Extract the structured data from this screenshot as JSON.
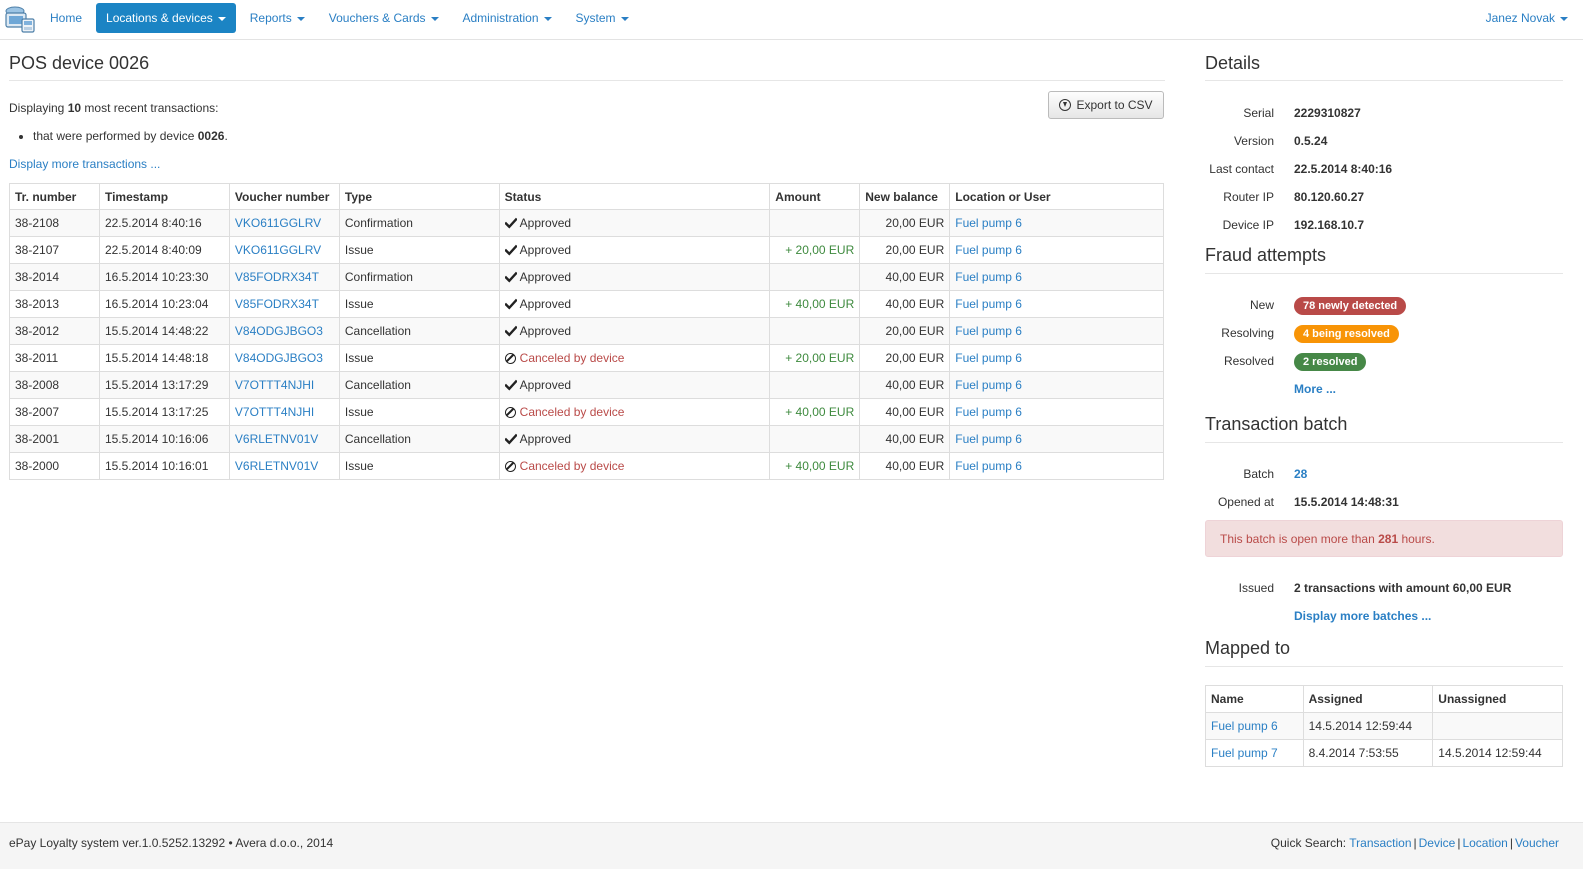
{
  "nav": {
    "items": [
      {
        "label": "Home",
        "active": false,
        "dropdown": false,
        "name": "nav-home"
      },
      {
        "label": "Locations & devices",
        "active": true,
        "dropdown": true,
        "name": "nav-locations-devices"
      },
      {
        "label": "Reports",
        "active": false,
        "dropdown": true,
        "name": "nav-reports"
      },
      {
        "label": "Vouchers & Cards",
        "active": false,
        "dropdown": true,
        "name": "nav-vouchers-cards"
      },
      {
        "label": "Administration",
        "active": false,
        "dropdown": true,
        "name": "nav-administration"
      },
      {
        "label": "System",
        "active": false,
        "dropdown": true,
        "name": "nav-system"
      }
    ],
    "user": "Janez Novak"
  },
  "page": {
    "title": "POS device 0026",
    "summary_prefix": "Displaying ",
    "summary_count": "10",
    "summary_suffix": " most recent transactions:",
    "filter_prefix": "that were performed by device ",
    "filter_device": "0026",
    "filter_suffix": ".",
    "more_link": "Display more transactions ...",
    "export_label": "Export to CSV"
  },
  "transactions": {
    "columns": [
      "Tr. number",
      "Timestamp",
      "Voucher number",
      "Type",
      "Status",
      "Amount",
      "New balance",
      "Location or User"
    ],
    "rows": [
      {
        "tr": "38-2108",
        "ts": "22.5.2014 8:40:16",
        "voucher": "VKO611GGLRV",
        "type": "Confirmation",
        "status": "Approved",
        "status_kind": "ok",
        "amount": "",
        "balance": "20,00 EUR",
        "location": "Fuel pump 6"
      },
      {
        "tr": "38-2107",
        "ts": "22.5.2014 8:40:09",
        "voucher": "VKO611GGLRV",
        "type": "Issue",
        "status": "Approved",
        "status_kind": "ok",
        "amount": "+ 20,00 EUR",
        "balance": "20,00 EUR",
        "location": "Fuel pump 6"
      },
      {
        "tr": "38-2014",
        "ts": "16.5.2014 10:23:30",
        "voucher": "V85FODRX34T",
        "type": "Confirmation",
        "status": "Approved",
        "status_kind": "ok",
        "amount": "",
        "balance": "40,00 EUR",
        "location": "Fuel pump 6"
      },
      {
        "tr": "38-2013",
        "ts": "16.5.2014 10:23:04",
        "voucher": "V85FODRX34T",
        "type": "Issue",
        "status": "Approved",
        "status_kind": "ok",
        "amount": "+ 40,00 EUR",
        "balance": "40,00 EUR",
        "location": "Fuel pump 6"
      },
      {
        "tr": "38-2012",
        "ts": "15.5.2014 14:48:22",
        "voucher": "V84ODGJBGO3",
        "type": "Cancellation",
        "status": "Approved",
        "status_kind": "ok",
        "amount": "",
        "balance": "20,00 EUR",
        "location": "Fuel pump 6"
      },
      {
        "tr": "38-2011",
        "ts": "15.5.2014 14:48:18",
        "voucher": "V84ODGJBGO3",
        "type": "Issue",
        "status": "Canceled by device",
        "status_kind": "cancel",
        "amount": "+ 20,00 EUR",
        "balance": "20,00 EUR",
        "location": "Fuel pump 6"
      },
      {
        "tr": "38-2008",
        "ts": "15.5.2014 13:17:29",
        "voucher": "V7OTTT4NJHI",
        "type": "Cancellation",
        "status": "Approved",
        "status_kind": "ok",
        "amount": "",
        "balance": "40,00 EUR",
        "location": "Fuel pump 6"
      },
      {
        "tr": "38-2007",
        "ts": "15.5.2014 13:17:25",
        "voucher": "V7OTTT4NJHI",
        "type": "Issue",
        "status": "Canceled by device",
        "status_kind": "cancel",
        "amount": "+ 40,00 EUR",
        "balance": "40,00 EUR",
        "location": "Fuel pump 6"
      },
      {
        "tr": "38-2001",
        "ts": "15.5.2014 10:16:06",
        "voucher": "V6RLETNV01V",
        "type": "Cancellation",
        "status": "Approved",
        "status_kind": "ok",
        "amount": "",
        "balance": "40,00 EUR",
        "location": "Fuel pump 6"
      },
      {
        "tr": "38-2000",
        "ts": "15.5.2014 10:16:01",
        "voucher": "V6RLETNV01V",
        "type": "Issue",
        "status": "Canceled by device",
        "status_kind": "cancel",
        "amount": "+ 40,00 EUR",
        "balance": "40,00 EUR",
        "location": "Fuel pump 6"
      }
    ]
  },
  "details": {
    "title": "Details",
    "rows": [
      {
        "label": "Serial",
        "value": "2229310827"
      },
      {
        "label": "Version",
        "value": "0.5.24"
      },
      {
        "label": "Last contact",
        "value": "22.5.2014 8:40:16"
      },
      {
        "label": "Router IP",
        "value": "80.120.60.27"
      },
      {
        "label": "Device IP",
        "value": "192.168.10.7"
      }
    ]
  },
  "fraud": {
    "title": "Fraud attempts",
    "new_label": "New",
    "new_badge": "78 newly detected",
    "resolving_label": "Resolving",
    "resolving_badge": "4 being resolved",
    "resolved_label": "Resolved",
    "resolved_badge": "2 resolved",
    "more": "More ..."
  },
  "batch": {
    "title": "Transaction batch",
    "batch_label": "Batch",
    "batch_value": "28",
    "opened_label": "Opened at",
    "opened_value": "15.5.2014 14:48:31",
    "alert_prefix": "This batch is open more than ",
    "alert_hours": "281",
    "alert_suffix": " hours.",
    "issued_label": "Issued",
    "issued_value": "2 transactions with amount 60,00 EUR",
    "more": "Display more batches ..."
  },
  "mapped": {
    "title": "Mapped to",
    "columns": [
      "Name",
      "Assigned",
      "Unassigned"
    ],
    "rows": [
      {
        "name": "Fuel pump 6",
        "assigned": "14.5.2014 12:59:44",
        "unassigned": ""
      },
      {
        "name": "Fuel pump 7",
        "assigned": "8.4.2014 7:53:55",
        "unassigned": "14.5.2014 12:59:44"
      }
    ]
  },
  "footer": {
    "left": "ePay Loyalty system ver.1.0.5252.13292 • Avera d.o.o., 2014",
    "quick_label": "Quick Search: ",
    "links": [
      "Transaction",
      "Device",
      "Location",
      "Voucher"
    ],
    "separator": "|"
  },
  "colors": {
    "accent": "#1b84c4",
    "link": "#2a7fc4",
    "danger": "#b94a48",
    "warning": "#f89406",
    "success": "#468847",
    "positive": "#3e8a3e"
  }
}
